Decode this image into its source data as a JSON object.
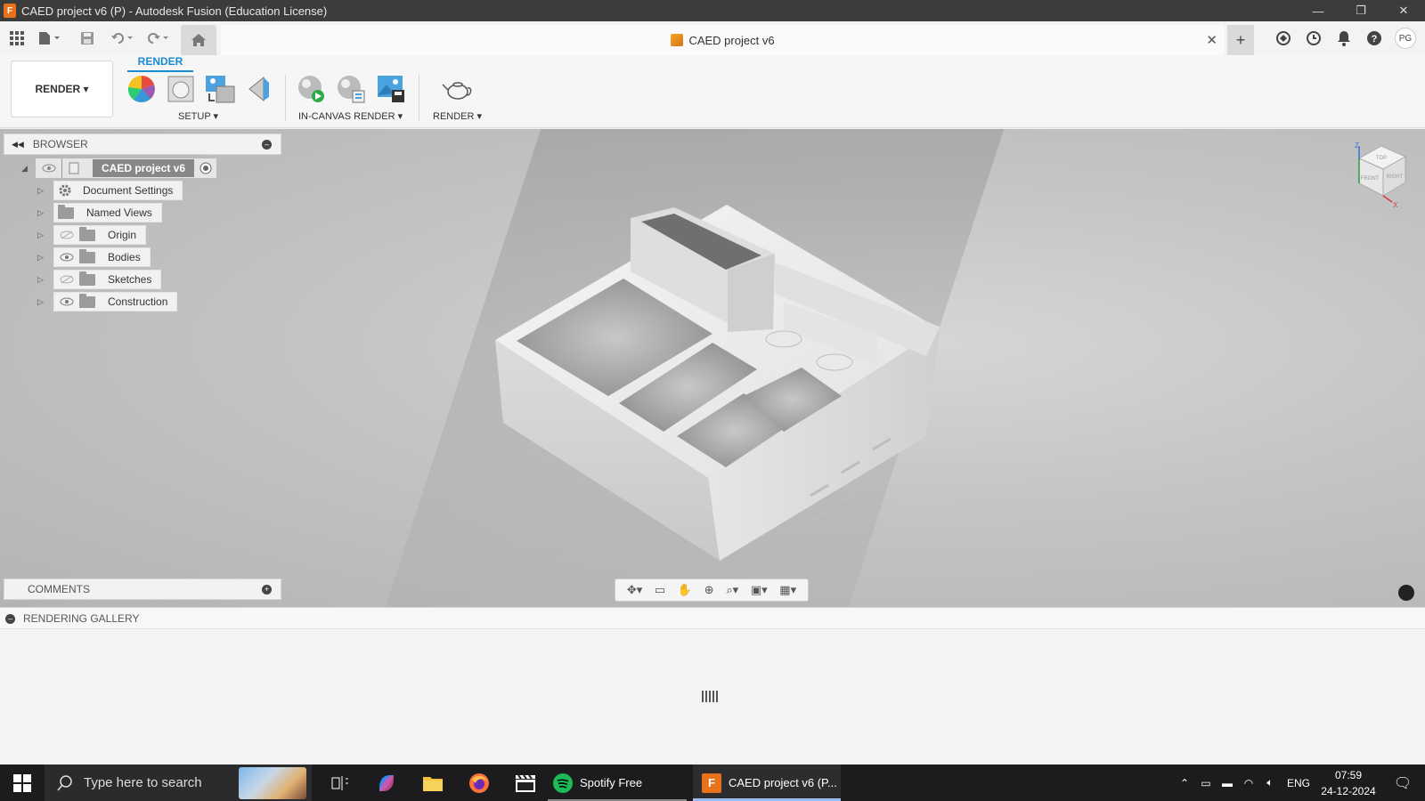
{
  "window": {
    "title": "CAED  project v6 (P) - Autodesk Fusion (Education License)",
    "controls": [
      "—",
      "❐",
      "✕"
    ]
  },
  "doc_tab": {
    "title": "CAED  project v6",
    "close": "✕",
    "new_tab": "+"
  },
  "header_icons": {
    "avatar": "PG"
  },
  "ribbon": {
    "workspace": "RENDER ▾",
    "active_tab": "RENDER",
    "groups": {
      "setup": "SETUP ▾",
      "in_canvas": "IN-CANVAS RENDER ▾",
      "render": "RENDER ▾"
    }
  },
  "browser": {
    "title": "BROWSER",
    "root": "CAED  project v6",
    "items": [
      {
        "label": "Document Settings",
        "icon": "gear"
      },
      {
        "label": "Named Views",
        "icon": "folder"
      },
      {
        "label": "Origin",
        "icon": "folder",
        "visible": false
      },
      {
        "label": "Bodies",
        "icon": "folder",
        "visible": true
      },
      {
        "label": "Sketches",
        "icon": "folder",
        "visible": false
      },
      {
        "label": "Construction",
        "icon": "folder",
        "visible": true
      }
    ]
  },
  "comments": {
    "title": "COMMENTS"
  },
  "gallery": {
    "title": "RENDERING GALLERY"
  },
  "viewcube": {
    "top": "TOP",
    "front": "FRONT",
    "right": "RIGHT",
    "z": "Z",
    "x": "X"
  },
  "taskbar": {
    "search_placeholder": "Type here to search",
    "apps": [
      {
        "label": "Spotify Free"
      },
      {
        "label": "CAED  project v6 (P..."
      }
    ],
    "lang": "ENG",
    "time": "07:59",
    "date": "24-12-2024"
  },
  "colors": {
    "accent": "#1a8ad0",
    "fusion_orange": "#e8711c",
    "spotify_green": "#1db954"
  }
}
